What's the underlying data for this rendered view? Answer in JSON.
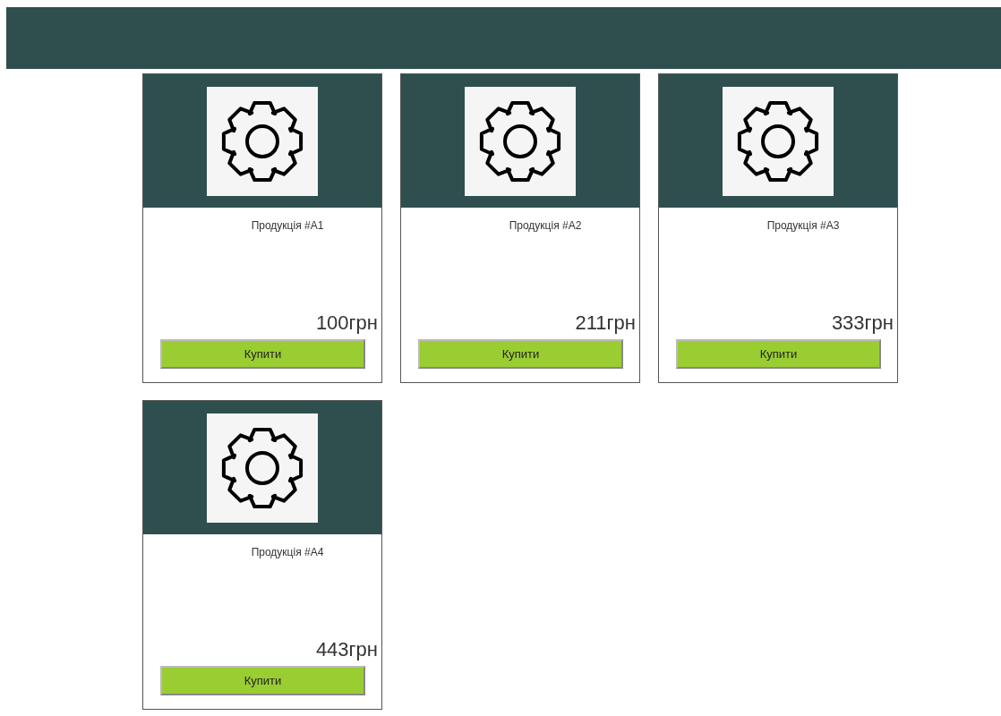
{
  "products": [
    {
      "title": "Продукція #A1",
      "price": "100грн",
      "button": "Купити"
    },
    {
      "title": "Продукція #A2",
      "price": "211грн",
      "button": "Купити"
    },
    {
      "title": "Продукція #A3",
      "price": "333грн",
      "button": "Купити"
    },
    {
      "title": "Продукція #A4",
      "price": "443грн",
      "button": "Купити"
    }
  ]
}
